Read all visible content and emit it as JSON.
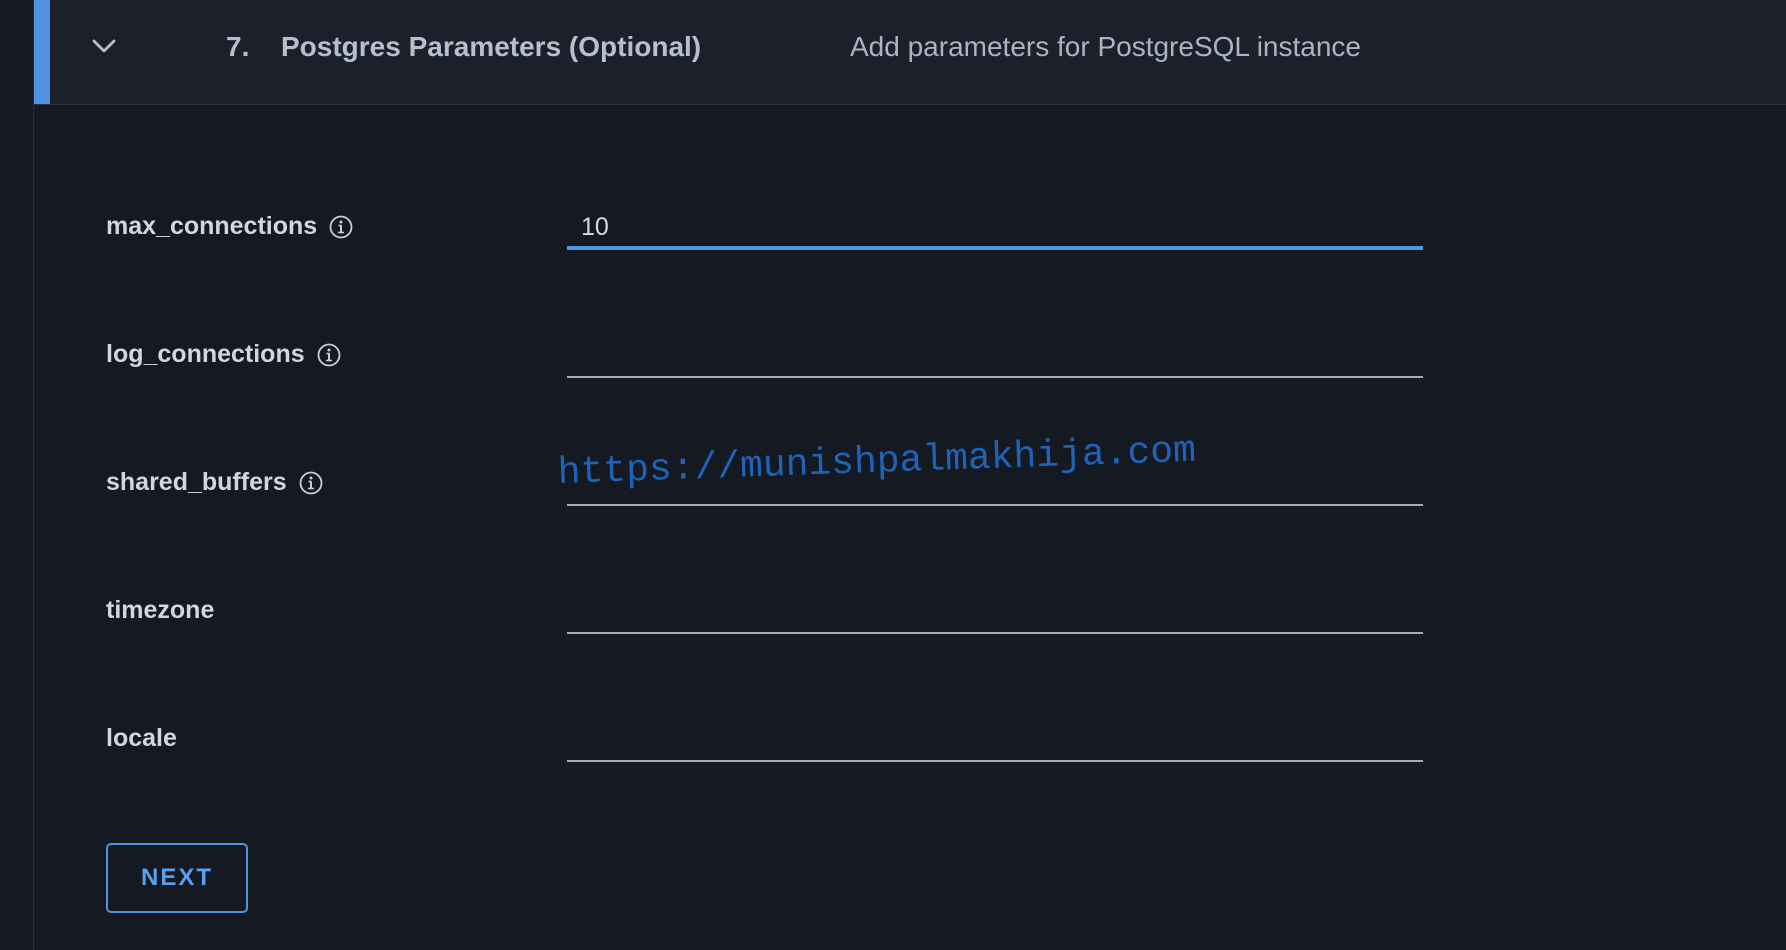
{
  "step": {
    "number": "7.",
    "title": "Postgres Parameters (Optional)",
    "description": "Add parameters for PostgreSQL instance",
    "expanded": true,
    "accent_color": "#4f93e2",
    "toggle_icon": "chevron-down-icon"
  },
  "fields": [
    {
      "label": "max_connections",
      "value": "10",
      "has_info": true,
      "focused": true
    },
    {
      "label": "log_connections",
      "value": "",
      "has_info": true,
      "focused": false
    },
    {
      "label": "shared_buffers",
      "value": "",
      "has_info": true,
      "focused": false
    },
    {
      "label": "timezone",
      "value": "",
      "has_info": false,
      "focused": false
    },
    {
      "label": "locale",
      "value": "",
      "has_info": false,
      "focused": false
    }
  ],
  "watermark": "https://munishpalmakhija.com",
  "actions": {
    "next_label": "NEXT"
  },
  "colors": {
    "background": "#141922",
    "header_background": "#1b202b",
    "focus_underline": "#4b97e6",
    "button_text": "#59a1ef"
  }
}
